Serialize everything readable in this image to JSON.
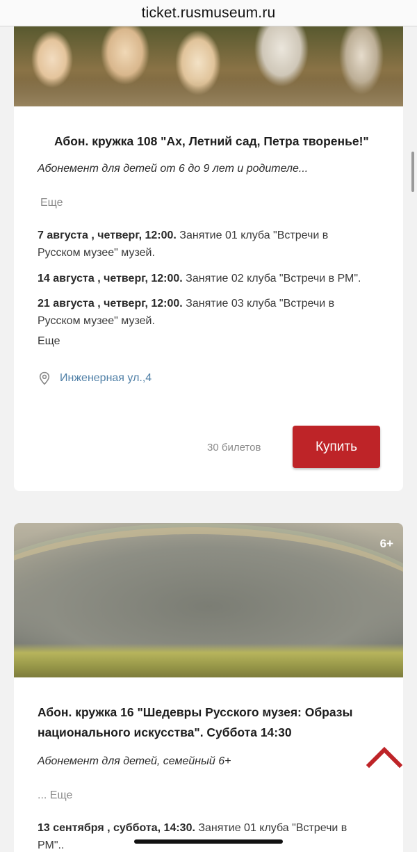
{
  "browser": {
    "url": "ticket.rusmuseum.ru"
  },
  "card1": {
    "title": "Абон. кружка 108 \"Ах, Летний сад, Петра творенье!\"",
    "subtitle": "Абонемент для детей от 6 до 9 лет и родителе...",
    "more_label": "Еще",
    "sessions": [
      {
        "date": "7 августа , четверг, 12:00.",
        "text": " Занятие 01 клуба \"Встречи в Русском музее\" музей."
      },
      {
        "date": "14 августа , четверг, 12:00.",
        "text": " Занятие 02 клуба \"Встречи в РМ\"."
      },
      {
        "date": "21 августа , четверг, 12:00.",
        "text": " Занятие 03 клуба \"Встречи в Русском музее\" музей."
      }
    ],
    "sessions_more_label": "Еще",
    "address": "Инженерная ул.,4",
    "tickets": "30 билетов",
    "buy_label": "Купить"
  },
  "card2": {
    "age": "6+",
    "title": "Абон. кружка 16 \"Шедевры Русского музея: Образы национального искусства\". Суббота 14:30",
    "subtitle": "Абонемент для детей, семейный 6+",
    "more_label": "... Еще",
    "sessions": [
      {
        "date": "13 сентября , суббота, 14:30.",
        "text": " Занятие 01 клуба \"Встречи в РМ\".."
      }
    ]
  },
  "colors": {
    "accent": "#be2428",
    "link": "#4f7fa6"
  },
  "icons": {
    "location": "location-pin-icon",
    "scroll_top": "chevron-up-icon"
  }
}
